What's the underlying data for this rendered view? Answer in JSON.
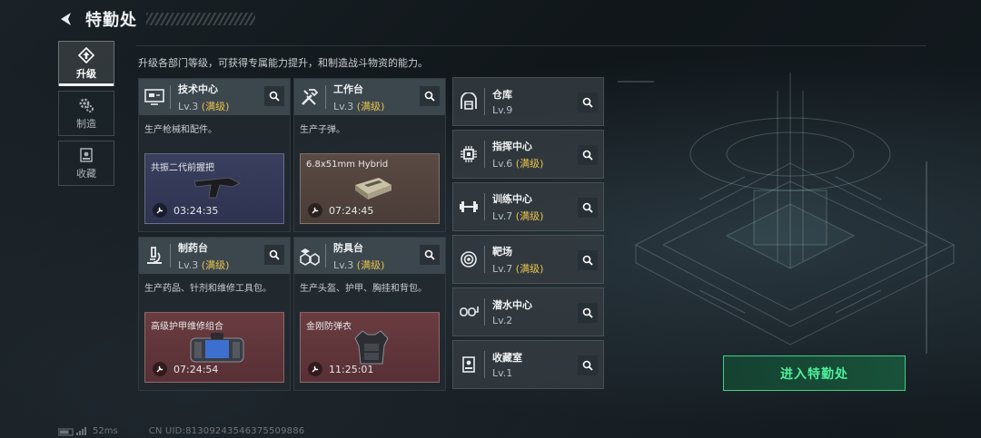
{
  "header": {
    "title": "特勤处"
  },
  "subtitle": "升级各部门等级，可获得专属能力提升，和制造战斗物资的能力。",
  "tabs": [
    {
      "label": "升级",
      "icon": "upgrade-arrow-icon",
      "active": true
    },
    {
      "label": "制造",
      "icon": "gear-icon",
      "active": false
    },
    {
      "label": "收藏",
      "icon": "collection-icon",
      "active": false
    }
  ],
  "facilities_main": [
    {
      "name": "技术中心",
      "level": "Lv.3",
      "max_tag": "(满级)",
      "icon": "monitor-icon",
      "desc": "生产枪械和配件。",
      "product": "共振二代前握把",
      "timer": "03:24:35",
      "theme": "blue"
    },
    {
      "name": "工作台",
      "level": "Lv.3",
      "max_tag": "(满级)",
      "icon": "tools-icon",
      "desc": "生产子弹。",
      "product": "6.8x51mm Hybrid",
      "timer": "07:24:45",
      "theme": "brown"
    },
    {
      "name": "制药台",
      "level": "Lv.3",
      "max_tag": "(满级)",
      "icon": "microscope-icon",
      "desc": "生产药品、针剂和维修工具包。",
      "product": "高级护甲维修组合",
      "timer": "07:24:54",
      "theme": "red"
    },
    {
      "name": "防具台",
      "level": "Lv.3",
      "max_tag": "(满级)",
      "icon": "armor-parts-icon",
      "desc": "生产头盔、护甲、胸挂和背包。",
      "product": "金刚防弹衣",
      "timer": "11:25:01",
      "theme": "red"
    }
  ],
  "facilities_side": [
    {
      "name": "仓库",
      "level": "Lv.9",
      "max_tag": "",
      "icon": "warehouse-icon"
    },
    {
      "name": "指挥中心",
      "level": "Lv.6",
      "max_tag": "(满级)",
      "icon": "chip-icon"
    },
    {
      "name": "训练中心",
      "level": "Lv.7",
      "max_tag": "(满级)",
      "icon": "dumbbell-icon"
    },
    {
      "name": "靶场",
      "level": "Lv.7",
      "max_tag": "(满级)",
      "icon": "target-icon"
    },
    {
      "name": "潜水中心",
      "level": "Lv.2",
      "max_tag": "",
      "icon": "diving-mask-icon"
    },
    {
      "name": "收藏室",
      "level": "Lv.1",
      "max_tag": "",
      "icon": "display-case-icon"
    }
  ],
  "enter_button": "进入特勤处",
  "status": {
    "ping": "52ms",
    "uid": "CN UID:8130924354637550988​6"
  },
  "colors": {
    "accent_green": "#3fd08a",
    "max_level": "#e7c24a"
  }
}
